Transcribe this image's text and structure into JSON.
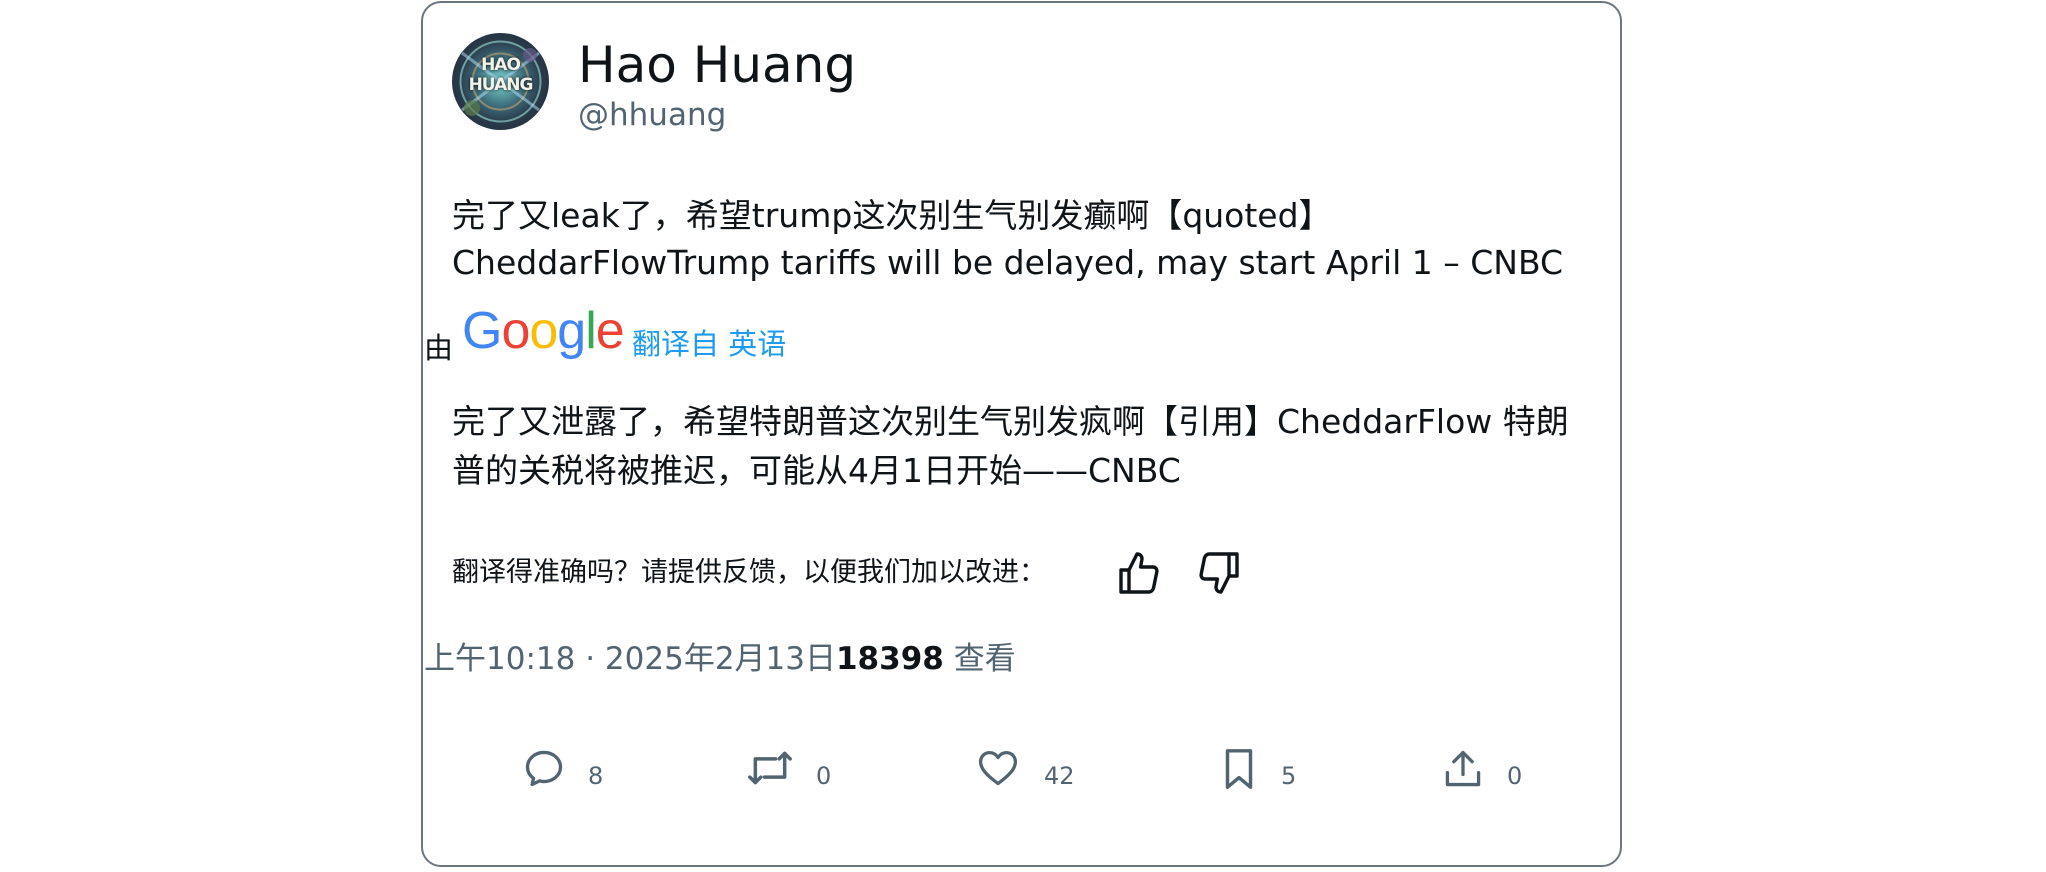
{
  "author": {
    "display_name": "Hao Huang",
    "handle": "@hhuang",
    "avatar_text": "HAO HUANG"
  },
  "tweet": {
    "text_line1": "完了又leak了，希望trump这次别生气别发癫啊【quoted】",
    "text_line2": "CheddarFlowTrump tariffs will be delayed, may start April 1 – CNBC"
  },
  "translation": {
    "by_label": "由",
    "provider": "Google",
    "translated_from": "翻译自 英语",
    "text_line1": "完了又泄露了，希望特朗普这次别生气别发疯啊【引用】CheddarFlow 特朗",
    "text_line2": "普的关税将被推迟，可能从4月1日开始——CNBC",
    "feedback_prompt": "翻译得准确吗？请提供反馈，以便我们加以改进："
  },
  "meta": {
    "time": "上午10:18",
    "separator": "·",
    "date": "2025年2月13日",
    "views_count": "18398",
    "views_label": "查看"
  },
  "actions": {
    "reply_count": "8",
    "retweet_count": "0",
    "like_count": "42",
    "bookmark_count": "5",
    "share_count": "0"
  },
  "colors": {
    "text_primary": "#0f1419",
    "text_secondary": "#536471",
    "link": "#1d9bf0",
    "border": "#6b7680"
  }
}
